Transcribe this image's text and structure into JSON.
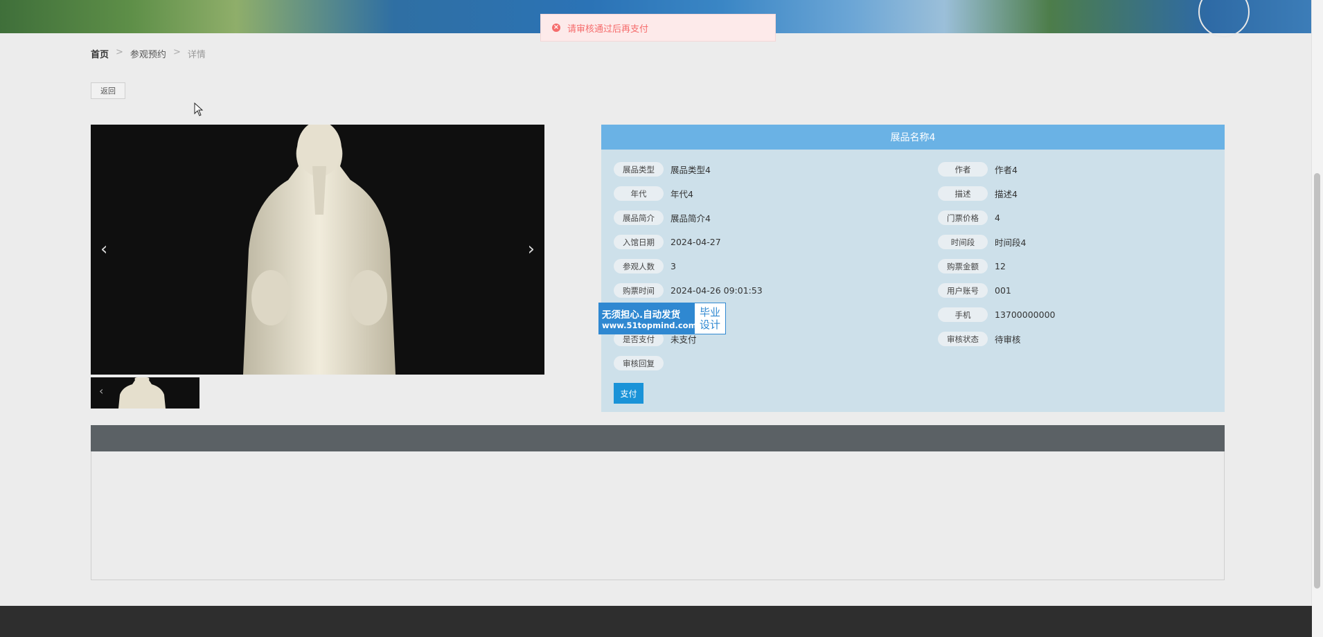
{
  "toast": {
    "message": "请审核通过后再支付"
  },
  "breadcrumb": {
    "home": "首页",
    "section": "参观预约",
    "current": "详情",
    "separator": ">"
  },
  "back_button": {
    "label": "返回"
  },
  "panel": {
    "title": "展品名称4",
    "fields_left": [
      {
        "label": "展品类型",
        "value": "展品类型4"
      },
      {
        "label": "年代",
        "value": "年代4"
      },
      {
        "label": "展品简介",
        "value": "展品简介4"
      },
      {
        "label": "入馆日期",
        "value": "2024-04-27"
      },
      {
        "label": "参观人数",
        "value": "3"
      },
      {
        "label": "购票时间",
        "value": "2024-04-26 09:01:53"
      },
      {
        "label": "",
        "value": ""
      },
      {
        "label": "是否支付",
        "value": "未支付"
      },
      {
        "label": "审核回复",
        "value": ""
      }
    ],
    "fields_right": [
      {
        "label": "作者",
        "value": "作者4"
      },
      {
        "label": "描述",
        "value": "描述4"
      },
      {
        "label": "门票价格",
        "value": "4"
      },
      {
        "label": "时间段",
        "value": "时间段4"
      },
      {
        "label": "购票金额",
        "value": "12"
      },
      {
        "label": "用户账号",
        "value": "001"
      },
      {
        "label": "手机",
        "value": "13700000000"
      },
      {
        "label": "审核状态",
        "value": "待审核"
      }
    ],
    "pay_button": "支付"
  },
  "watermark": {
    "line1": "无须担心.自动发货",
    "line2": "www.51topmind.com",
    "right1": "毕业",
    "right2": "设计"
  },
  "icons": {
    "toast": "error-circle-icon",
    "prev": "chevron-left-icon",
    "next": "chevron-right-icon",
    "cursor": "mouse-cursor-icon"
  },
  "colors": {
    "panel_header": "#6ab2e5",
    "pay_button": "#1a93d8",
    "toast_text": "#f56c6c"
  }
}
